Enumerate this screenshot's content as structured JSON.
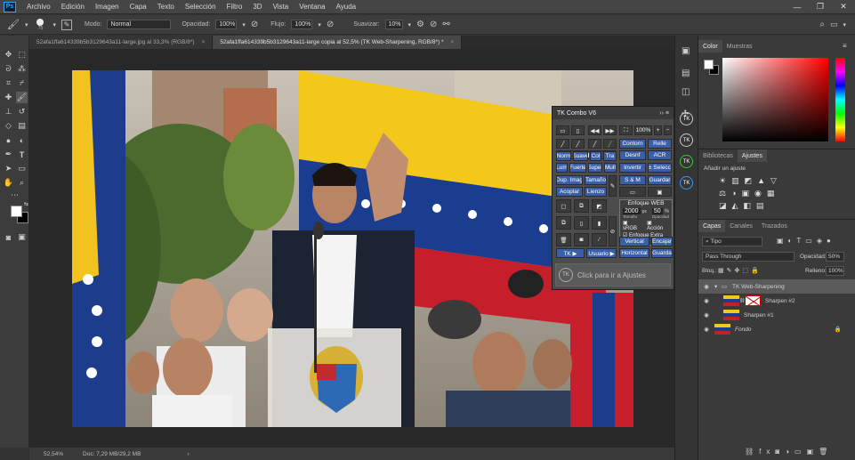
{
  "menubar": {
    "logo": "Ps",
    "items": [
      "Archivo",
      "Edición",
      "Imagen",
      "Capa",
      "Texto",
      "Selección",
      "Filtro",
      "3D",
      "Vista",
      "Ventana",
      "Ayuda"
    ],
    "window_buttons": [
      "—",
      "❐",
      "✕"
    ]
  },
  "options": {
    "brush_size": "75",
    "mode_label": "Modo:",
    "mode_value": "Normal",
    "opacity_label": "Opacidad:",
    "opacity_value": "100%",
    "flow_label": "Flujo:",
    "flow_value": "100%",
    "smooth_label": "Suavizar:",
    "smooth_value": "10%"
  },
  "tabs": [
    {
      "label": "52afa1ffa614339b5b3129643a11-large.jpg al 33,3% (RGB/8*)",
      "close": "×"
    },
    {
      "label": "52afa1ffa614339b5b3129643a11-large copia al 52,5% (TK Web-Sharpening, RGB/8*) *",
      "close": "×"
    }
  ],
  "status": {
    "zoom": "52,54%",
    "doc": "Doc: 7,29 MB/29,2 MB",
    "arrow": "›"
  },
  "tk": {
    "title": "TK Combo V6",
    "zoom": "100%",
    "buttons": {
      "contorn": "Contorn",
      "relle": "Relle",
      "desnf": "Desnf",
      "acr": "ACR",
      "norm": "Norm",
      "suave": "Suave",
      "col": "Col",
      "tra": "Tra",
      "lum": "Lum",
      "fuerte": "Fuerte",
      "super": "Super",
      "mult": "Mult",
      "invertir": "Invertir",
      "selecc": "± Selecc",
      "dup_imag": "Dup. Imag",
      "tamano": "Tamaño",
      "sm": "S & M",
      "guardar": "Guardar",
      "acoplar": "Acoplar",
      "lienzo": "Lienzo",
      "enfoque_web": "Enfoque WEB",
      "size_val": "2000",
      "px": "px",
      "op_val": "50",
      "pct": "%",
      "tamano_lbl": "Tamaño",
      "opacidad_lbl": "Opacidad",
      "srgb": "sRGB",
      "accion": "Acción",
      "enfoque_extra": "Enfoque Extra",
      "vertical": "Vertical",
      "encajar": "Encajar",
      "horizontal": "Horizontal",
      "guarda": "Guarda",
      "tk_menu": "TK ▶",
      "usuario": "Usuario ▶",
      "click_ajustes": "Click para ir a Ajustes"
    }
  },
  "right": {
    "color_tabs": [
      "Color",
      "Muestras"
    ],
    "lib_tabs": [
      "Bibliotecas",
      "Ajustes"
    ],
    "add_adjust": "Añadir un ajuste",
    "layer_tabs": [
      "Capas",
      "Canales",
      "Trazados"
    ],
    "filter_kind": "Tipo",
    "blend_mode": "Pass Through",
    "opacity_label": "Opacidad:",
    "opacity_value": "50%",
    "lock_label": "Bloq.:",
    "fill_label": "Relleno:",
    "fill_value": "100%",
    "layers": [
      {
        "name": "TK Web-Sharpening"
      },
      {
        "name": "Sharpen #2"
      },
      {
        "name": "Sharpen #1"
      },
      {
        "name": "Fondo"
      }
    ],
    "tk_icons": [
      "TK",
      "TK",
      "TK",
      "TK"
    ]
  },
  "colors": {
    "accent": "#31a8ff",
    "fg": "#ffffff",
    "bg": "#000000"
  }
}
